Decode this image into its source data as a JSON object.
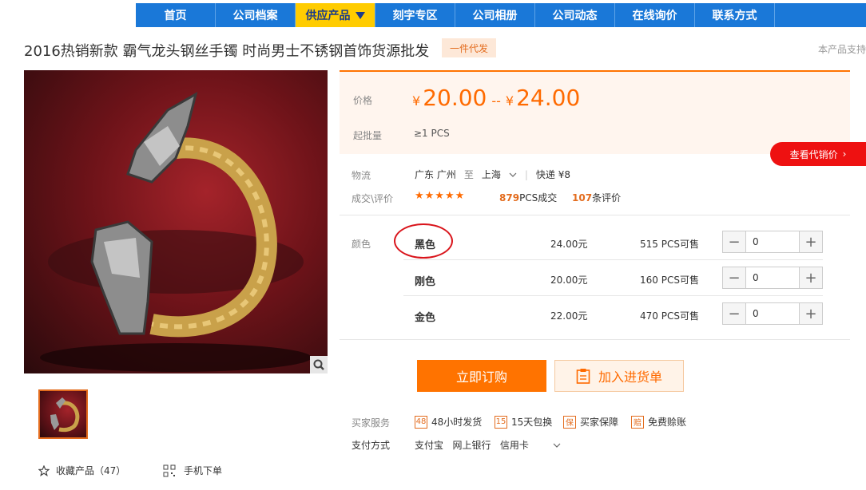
{
  "nav": {
    "items": [
      {
        "label": "首页"
      },
      {
        "label": "公司档案"
      },
      {
        "label": "供应产品"
      },
      {
        "label": "刻字专区"
      },
      {
        "label": "公司相册"
      },
      {
        "label": "公司动态"
      },
      {
        "label": "在线询价"
      },
      {
        "label": "联系方式"
      }
    ]
  },
  "product": {
    "title": "2016热销新款 霸气龙头钢丝手镯 时尚男士不锈钢首饰货源批发",
    "badge": "一件代发",
    "support_note": "本产品支持"
  },
  "price": {
    "label": "价格",
    "currency": "¥",
    "low": "20.00",
    "separator": "--",
    "high": "24.00",
    "moq_label": "起批量",
    "moq": "≥1  PCS",
    "agent_button": "查看代销价"
  },
  "logistics": {
    "label": "物流",
    "from": "广东 广州",
    "to_word": "至",
    "to": "上海",
    "express": "快递 ¥8"
  },
  "reviews": {
    "label": "成交\\评价",
    "stars": "★★★★★",
    "deals_count": "879",
    "deals_suffix": "PCS成交",
    "review_count": "107",
    "review_suffix": "条评价"
  },
  "variants": {
    "label": "颜色",
    "rows": [
      {
        "name": "黑色",
        "price": "24.00元",
        "stock": "515 PCS可售",
        "qty": "0"
      },
      {
        "name": "刚色",
        "price": "20.00元",
        "stock": "160 PCS可售",
        "qty": "0"
      },
      {
        "name": "金色",
        "price": "22.00元",
        "stock": "470 PCS可售",
        "qty": "0"
      }
    ]
  },
  "actions": {
    "buy": "立即订购",
    "cart": "加入进货单"
  },
  "services": {
    "label": "买家服务",
    "items": [
      {
        "icon": "48",
        "text": "48小时发货"
      },
      {
        "icon": "15",
        "text": "15天包换"
      },
      {
        "icon": "保",
        "text": "买家保障"
      },
      {
        "icon": "赔",
        "text": "免费赊账"
      }
    ]
  },
  "payment": {
    "label": "支付方式",
    "methods": "支付宝   网上银行   信用卡"
  },
  "footer": {
    "favorite": "收藏产品（47）",
    "mobile": "手机下单"
  },
  "colors": {
    "nav_blue": "#1a78d8",
    "nav_active": "#ffcc00",
    "accent_orange": "#ff7300",
    "agent_red": "#ee1111"
  }
}
